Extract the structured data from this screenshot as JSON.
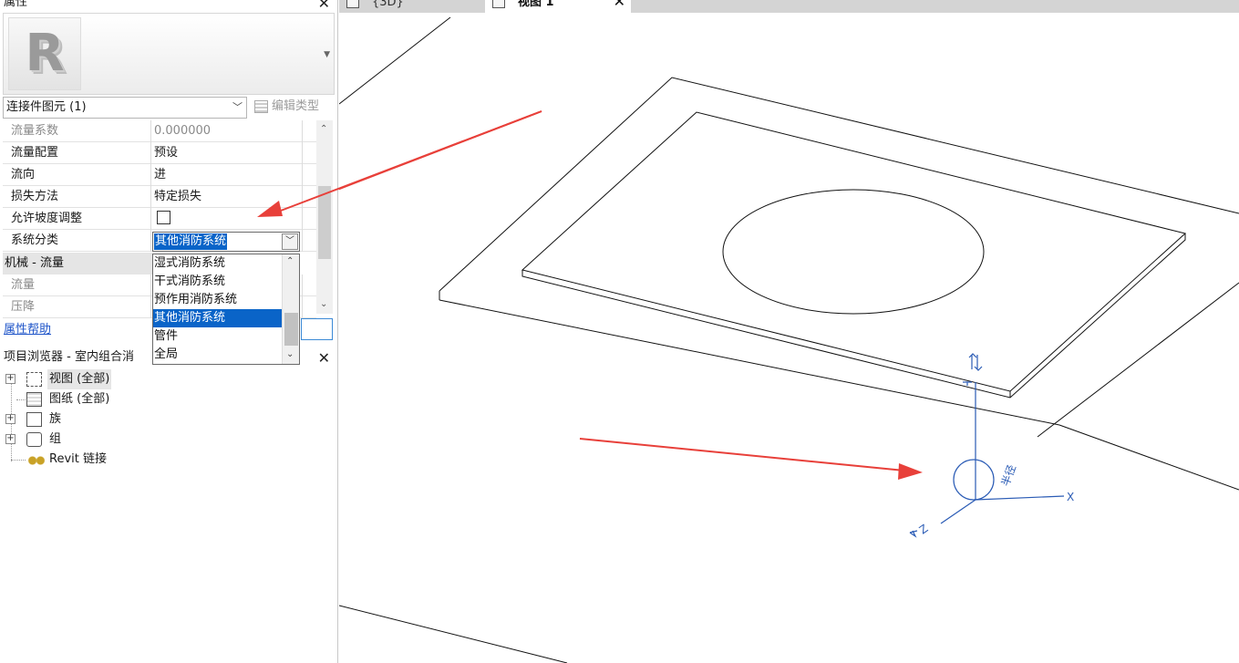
{
  "properties_panel": {
    "title": "属性",
    "close_glyph": "✕",
    "logo_letter": "R",
    "instance_selector": "连接件图元 (1)",
    "edit_type_label": "编辑类型",
    "rows": [
      {
        "name": "流量系数",
        "value": "0.000000"
      },
      {
        "name": "流量配置",
        "value": "预设"
      },
      {
        "name": "流向",
        "value": "进"
      },
      {
        "name": "损失方法",
        "value": "特定损失"
      },
      {
        "name": "允许坡度调整",
        "value": ""
      },
      {
        "name": "系统分类",
        "value": "其他消防系统"
      }
    ],
    "group_header": "机械 - 流量",
    "group_rows": [
      {
        "name": "流量",
        "value": ""
      },
      {
        "name": "压降",
        "value": ""
      }
    ],
    "dropdown_options": [
      "湿式消防系统",
      "干式消防系统",
      "预作用消防系统",
      "其他消防系统",
      "管件",
      "全局"
    ],
    "dropdown_selected": "其他消防系统",
    "help_link": "属性帮助"
  },
  "project_browser": {
    "title": "项目浏览器 - 室内组合消",
    "close_glyph": "✕",
    "items": [
      {
        "label": "视图 (全部)",
        "icon": "views-icon"
      },
      {
        "label": "图纸 (全部)",
        "icon": "sheets-icon"
      },
      {
        "label": "族",
        "icon": "families-icon"
      },
      {
        "label": "组",
        "icon": "groups-icon"
      },
      {
        "label": "Revit 链接",
        "icon": "revit-links-icon"
      }
    ]
  },
  "view_tabs": [
    {
      "label": "{3D}",
      "icon": "cube-icon"
    },
    {
      "label": "视图 1",
      "icon": "cube-icon"
    }
  ],
  "canvas": {
    "axis_labels": {
      "x": "X",
      "z": "Z",
      "radius": "半径"
    },
    "annotation_color": "#e8403a",
    "connector_color": "#2a5bb5"
  }
}
